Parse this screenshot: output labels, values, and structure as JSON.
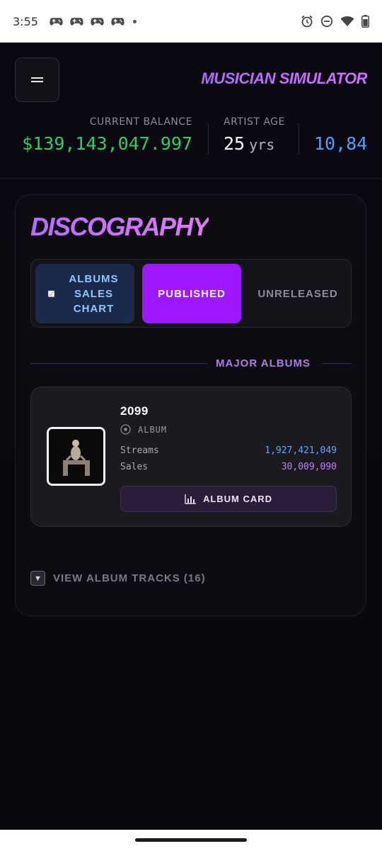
{
  "status_bar": {
    "time": "3:55",
    "notification_icons": [
      "game-controller-icon",
      "game-controller-icon",
      "game-controller-icon",
      "game-controller-icon"
    ],
    "system_icons": [
      "alarm-icon",
      "do-not-disturb-icon",
      "wifi-icon",
      "battery-icon"
    ]
  },
  "header": {
    "app_title": "MUSICIAN SIMULATOR",
    "stats": {
      "balance_label": "CURRENT BALANCE",
      "balance_value": "$139,143,047.997",
      "age_label": "ARTIST AGE",
      "age_value": "25",
      "age_unit": "yrs",
      "third_value": "10,84"
    }
  },
  "discography": {
    "title": "DISCOGRAPHY",
    "tabs": {
      "chart_label": "ALBUMS SALES CHART",
      "published_label": "PUBLISHED",
      "unreleased_label": "UNRELEASED",
      "active": "PUBLISHED"
    },
    "section_heading": "MAJOR ALBUMS",
    "albums": [
      {
        "title": "2099",
        "type": "ALBUM",
        "streams_label": "Streams",
        "streams_value": "1,927,421,049",
        "sales_label": "Sales",
        "sales_value": "30,009,090",
        "button_label": "ALBUM CARD"
      }
    ],
    "tracks_toggle_label": "VIEW ALBUM TRACKS (16)"
  },
  "colors": {
    "accent_purple": "#9d17ff",
    "balance_green": "#22d36a",
    "streams_blue": "#5aa8ff",
    "sales_purple": "#c57cff"
  }
}
